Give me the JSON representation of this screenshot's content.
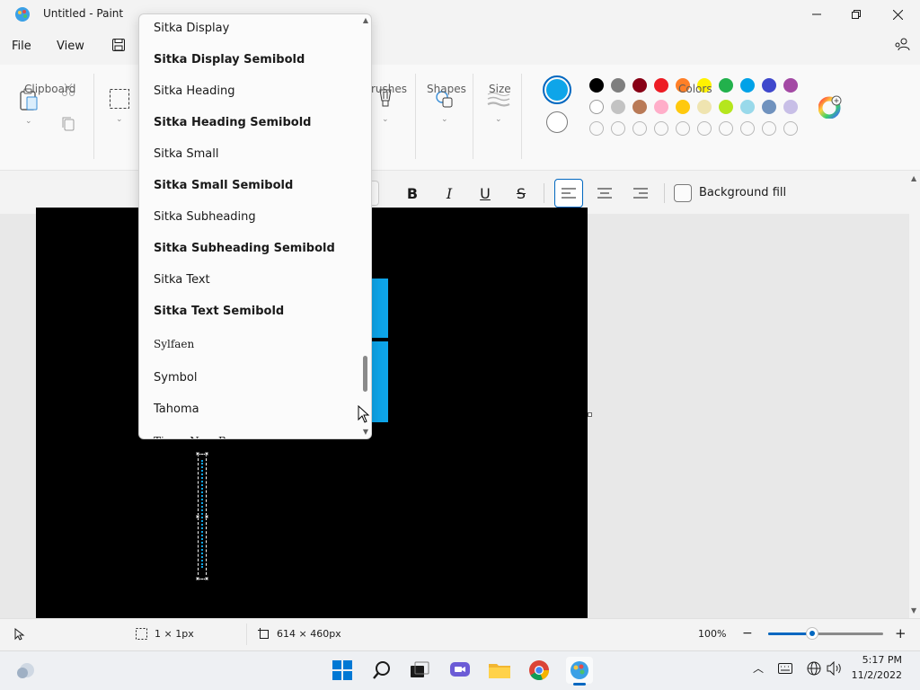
{
  "window": {
    "title": "Untitled - Paint"
  },
  "menu": {
    "file": "File",
    "view": "View"
  },
  "ribbon": {
    "groups": {
      "clipboard": "Clipboard",
      "brushes": "rushes",
      "shapes": "Shapes",
      "size": "Size",
      "colors": "Colors"
    }
  },
  "colors": {
    "primary": "#0ea5e9",
    "secondary": "#ffffff",
    "palette_row1": [
      "#000000",
      "#7f7f7f",
      "#880015",
      "#ed1c24",
      "#ff7f27",
      "#fff200",
      "#22b14c",
      "#00a2e8",
      "#3f48cc",
      "#a349a4"
    ],
    "palette_row2": [
      "#ffffff",
      "#c3c3c3",
      "#b97a57",
      "#ffaec9",
      "#ffc90e",
      "#efe4b0",
      "#b5e61d",
      "#99d9ea",
      "#7092be",
      "#c8bfe7"
    ]
  },
  "text_toolbar": {
    "bold": "B",
    "italic": "I",
    "underline": "U",
    "strikethrough": "S",
    "background_fill": "Background fill"
  },
  "font_dropdown": {
    "items": [
      "Sitka Display",
      "Sitka Display Semibold",
      "Sitka Heading",
      "Sitka Heading Semibold",
      "Sitka Small",
      "Sitka Small Semibold",
      "Sitka Subheading",
      "Sitka Subheading Semibold",
      "Sitka Text",
      "Sitka Text Semibold",
      "Sylfaen",
      "Symbol",
      "Tahoma",
      "Times New Roman"
    ]
  },
  "status": {
    "selection_size": "1 × 1px",
    "canvas_size": "614 × 460px",
    "zoom": "100%",
    "zoom_fraction": 0.38
  },
  "taskbar": {
    "time": "5:17 PM",
    "date": "11/2/2022"
  }
}
